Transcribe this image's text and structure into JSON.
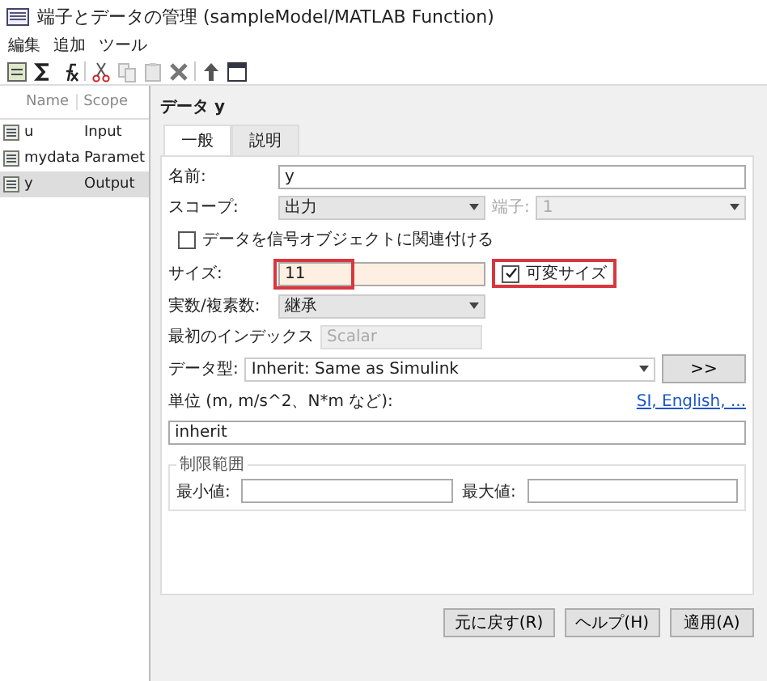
{
  "window": {
    "title": "端子とデータの管理 (sampleModel/MATLAB Function)"
  },
  "menu": [
    "編集",
    "追加",
    "ツール"
  ],
  "toolbar": [
    {
      "kind": "list"
    },
    {
      "kind": "sigma"
    },
    {
      "kind": "fx"
    },
    {
      "kind": "sep"
    },
    {
      "kind": "cut"
    },
    {
      "kind": "copy"
    },
    {
      "kind": "paste"
    },
    {
      "kind": "delete"
    },
    {
      "kind": "sep"
    },
    {
      "kind": "up"
    },
    {
      "kind": "window"
    }
  ],
  "list": {
    "columns": [
      "Name",
      "Scope"
    ],
    "rows": [
      {
        "name": "u",
        "scope": "Input",
        "selected": false
      },
      {
        "name": "mydata",
        "scope": "Paramet",
        "selected": false
      },
      {
        "name": "y",
        "scope": "Output",
        "selected": true
      }
    ]
  },
  "panel": {
    "title": "データ y",
    "tabs": [
      {
        "label": "一般",
        "selected": true
      },
      {
        "label": "説明",
        "selected": false
      }
    ],
    "name": {
      "label": "名前:",
      "value": "y"
    },
    "scope": {
      "label": "スコープ:",
      "value": "出力"
    },
    "port": {
      "label": "端子:",
      "value": "1",
      "disabled": true
    },
    "signal_object": {
      "label": "データを信号オブジェクトに関連付ける",
      "checked": false
    },
    "size": {
      "label": "サイズ:",
      "value": "11",
      "highlighted": true
    },
    "variable_size": {
      "label": "可変サイズ",
      "checked": true,
      "highlighted": true
    },
    "complexity": {
      "label": "実数/複素数:",
      "value": "継承"
    },
    "first_index": {
      "label": "最初のインデックス",
      "value": "Scalar",
      "disabled": true
    },
    "data_type": {
      "label": "データ型:",
      "value": "Inherit: Same as Simulink",
      "button": ">>"
    },
    "unit": {
      "label": "単位 (m, m/s^2、N*m など):",
      "link": "SI, English, ...",
      "value": "inherit"
    },
    "limits": {
      "title": "制限範囲",
      "min_label": "最小値:",
      "max_label": "最大値:"
    }
  },
  "buttons": [
    "元に戻す(R)",
    "ヘルプ(H)",
    "適用(A)"
  ]
}
